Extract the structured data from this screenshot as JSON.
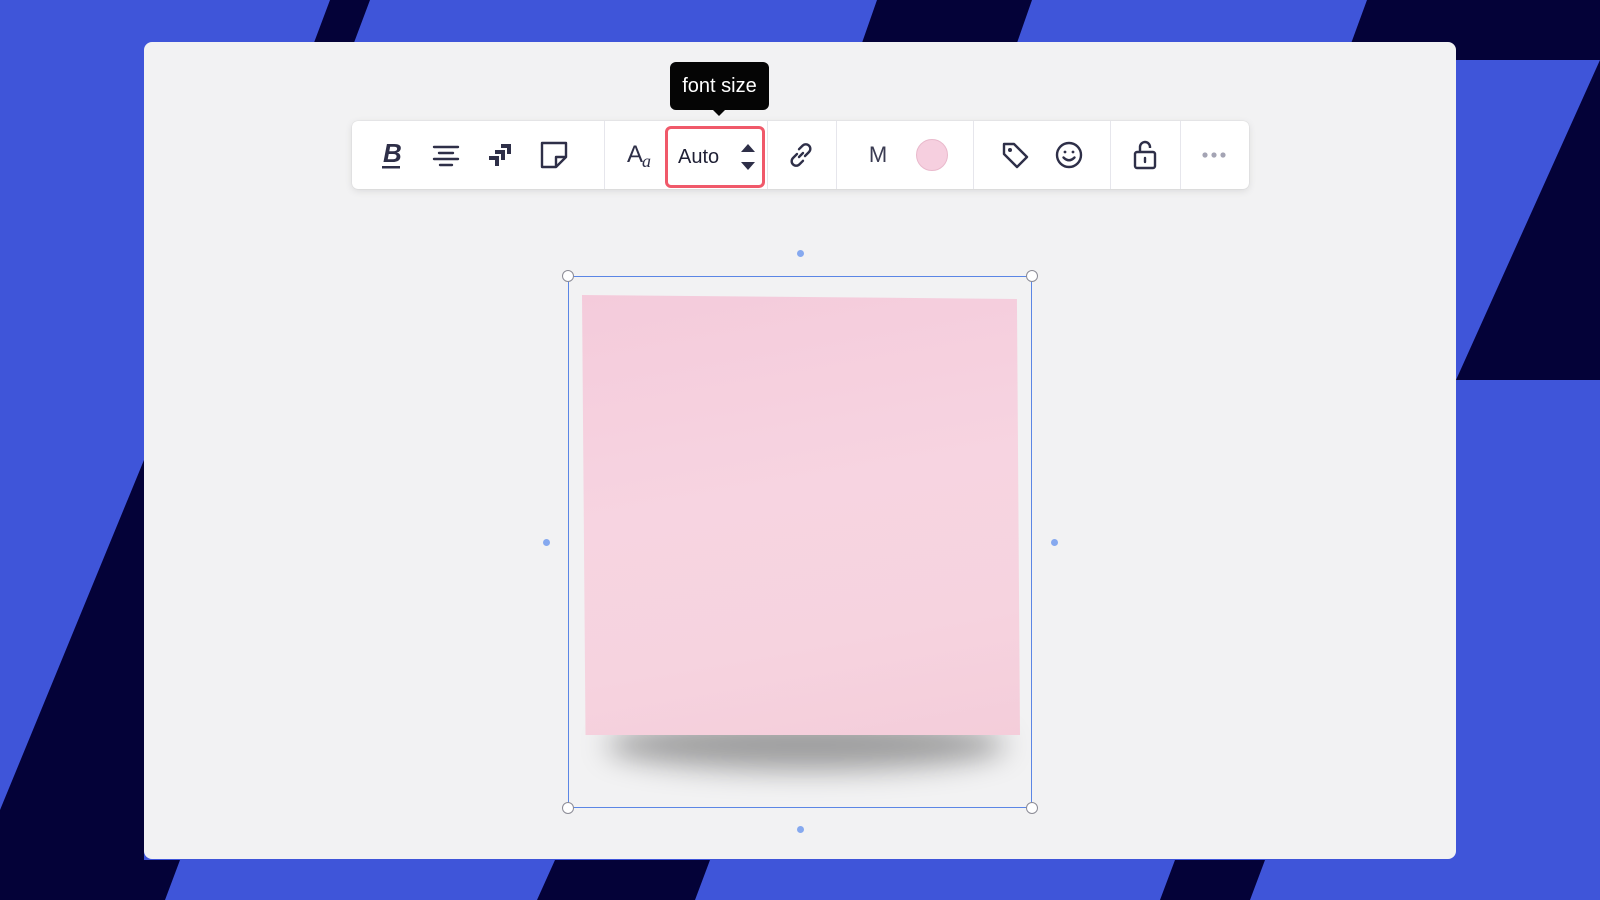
{
  "tooltip": {
    "text": "font size"
  },
  "toolbar": {
    "tools": [
      {
        "name": "bold",
        "icon": "bold-icon"
      },
      {
        "name": "align",
        "icon": "align-center-icon"
      },
      {
        "name": "jira",
        "icon": "jira-icon"
      },
      {
        "name": "sticky-shape",
        "icon": "sticky-note-icon"
      },
      {
        "name": "font",
        "icon": "font-icon"
      },
      {
        "name": "link",
        "icon": "link-icon"
      },
      {
        "name": "tag",
        "icon": "tag-icon"
      },
      {
        "name": "reaction",
        "icon": "emoji-icon"
      },
      {
        "name": "lock",
        "icon": "unlock-icon"
      },
      {
        "name": "more",
        "icon": "more-icon"
      }
    ],
    "font_size": {
      "value": "Auto"
    },
    "size_letter": "M",
    "sticky_color": "#f6cfdf"
  },
  "colors": {
    "background_blue": "#3f55d9",
    "background_navy": "#040238",
    "canvas": "#f2f2f3",
    "highlight": "#f0596a",
    "selection": "#5b86e5"
  }
}
